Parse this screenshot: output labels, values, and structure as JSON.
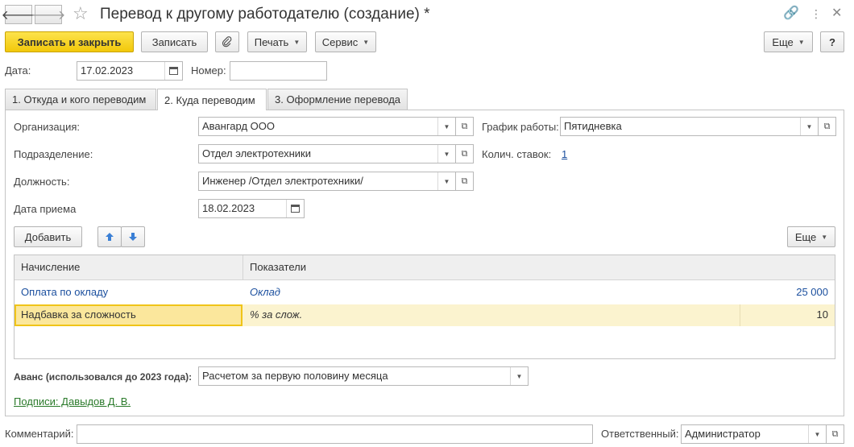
{
  "window": {
    "title": "Перевод к другому работодателю (создание) *",
    "back_icon": "arrow-left-icon",
    "forward_icon": "arrow-right-icon"
  },
  "toolbar": {
    "save_close": "Записать и закрыть",
    "save": "Записать",
    "print": "Печать",
    "service": "Сервис",
    "more": "Еще",
    "help": "?"
  },
  "header": {
    "date_label": "Дата:",
    "date_value": "17.02.2023",
    "number_label": "Номер:",
    "number_value": ""
  },
  "tabs": [
    {
      "label": "1. Откуда и кого переводим"
    },
    {
      "label": "2. Куда переводим"
    },
    {
      "label": "3. Оформление перевода"
    }
  ],
  "form": {
    "org_label": "Организация:",
    "org_value": "Авангард ООО",
    "dept_label": "Подразделение:",
    "dept_value": "Отдел электротехники",
    "pos_label": "Должность:",
    "pos_value": "Инженер /Отдел электротехники/",
    "hire_label": "Дата приема",
    "hire_value": "18.02.2023",
    "schedule_label": "График работы:",
    "schedule_value": "Пятидневка",
    "rates_label": "Колич. ставок:",
    "rates_value": "1"
  },
  "table_toolbar": {
    "add": "Добавить",
    "more": "Еще"
  },
  "table": {
    "headers": [
      "Начисление",
      "Показатели"
    ],
    "rows": [
      {
        "accrual": "Оплата по окладу",
        "indicator": "Оклад",
        "value": "25 000"
      },
      {
        "accrual": "Надбавка за сложность",
        "indicator": "% за слож.",
        "value": "10"
      }
    ]
  },
  "advance": {
    "label": "Аванс (использовался до 2023 года):",
    "value": "Расчетом за первую половину месяца"
  },
  "signatures": "Подписи: Давыдов Д. В.",
  "footer": {
    "comment_label": "Комментарий:",
    "comment_value": "",
    "responsible_label": "Ответственный:",
    "responsible_value": "Администратор"
  },
  "colors": {
    "primary_button": "#f2c80a",
    "selected_row": "#fbf3cf",
    "link": "#1b4f9e"
  }
}
